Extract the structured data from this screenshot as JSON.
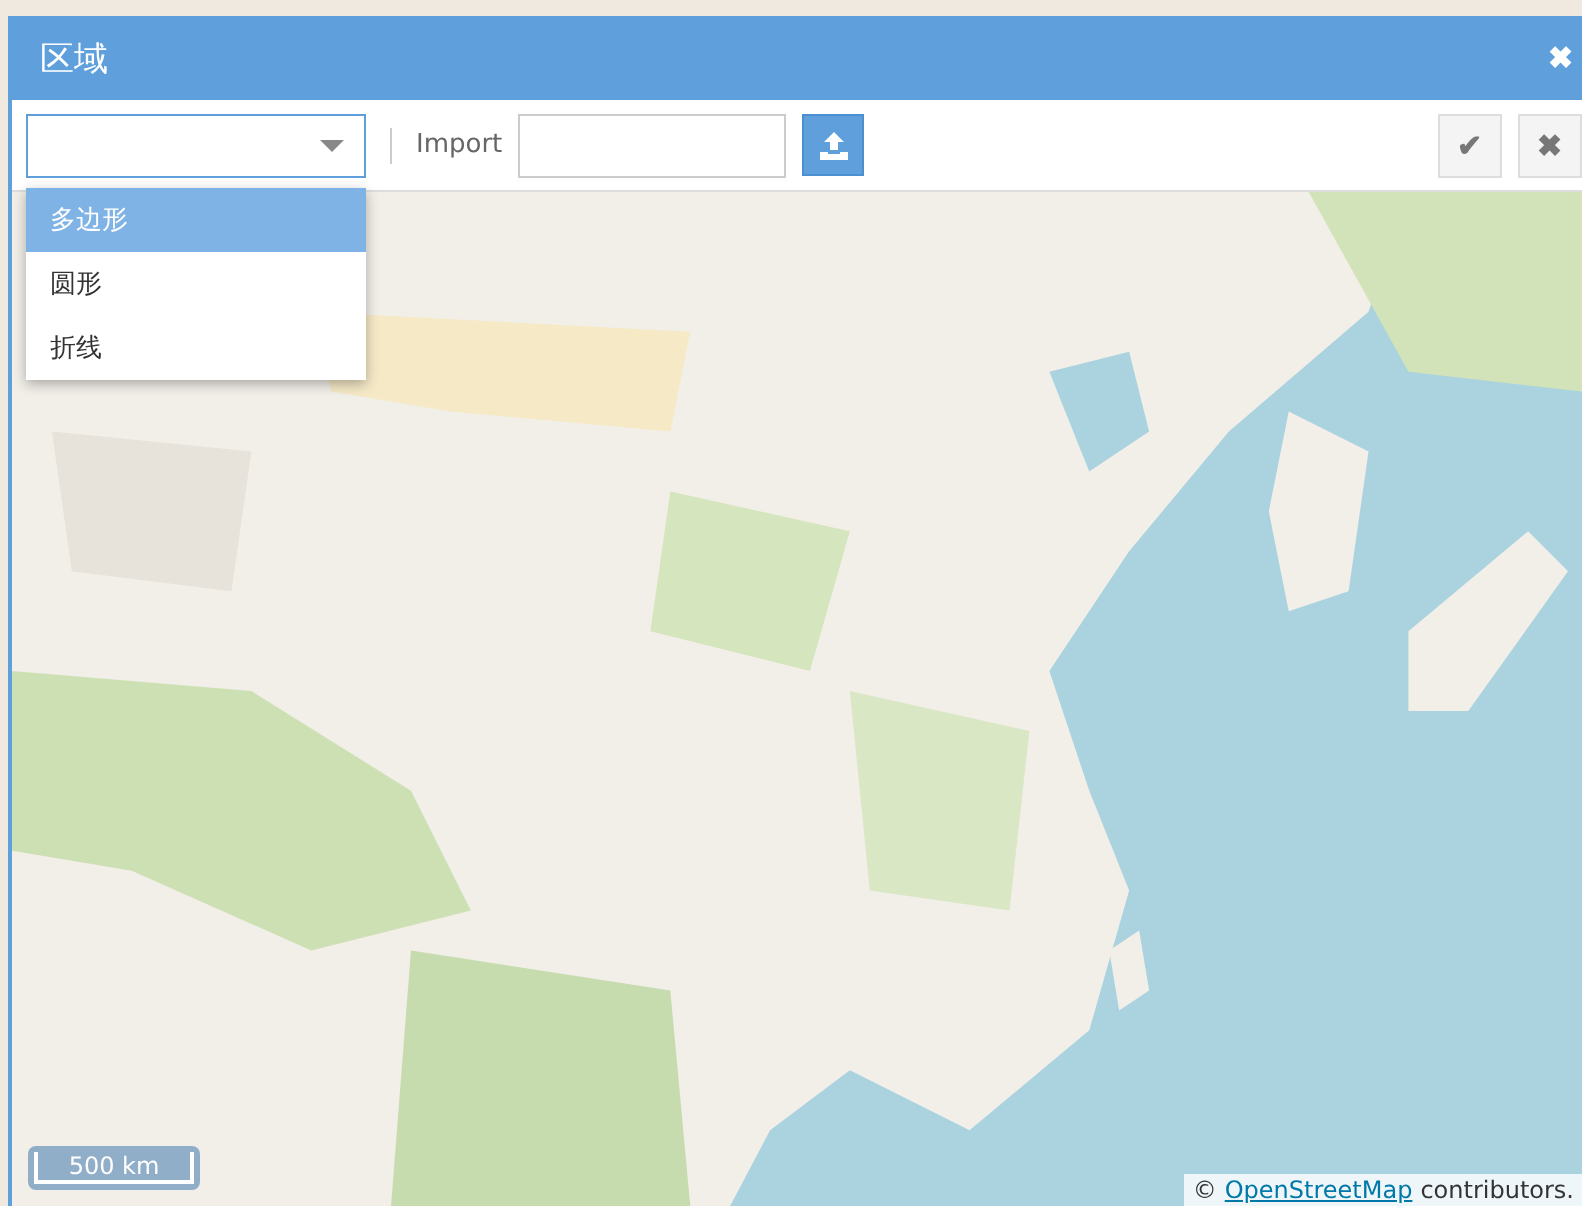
{
  "dialog": {
    "title": "区域",
    "close": "✖"
  },
  "toolbar": {
    "shape_select": {
      "options": [
        {
          "label": "多边形",
          "selected": true
        },
        {
          "label": "圆形",
          "selected": false
        },
        {
          "label": "折线",
          "selected": false
        }
      ],
      "expanded": true
    },
    "import_label": "Import",
    "confirm": "✔",
    "cancel": "✖"
  },
  "map": {
    "scale": "500 km",
    "attribution": {
      "prefix": "©",
      "link": "OpenStreetMap",
      "suffix": "contributors."
    }
  }
}
